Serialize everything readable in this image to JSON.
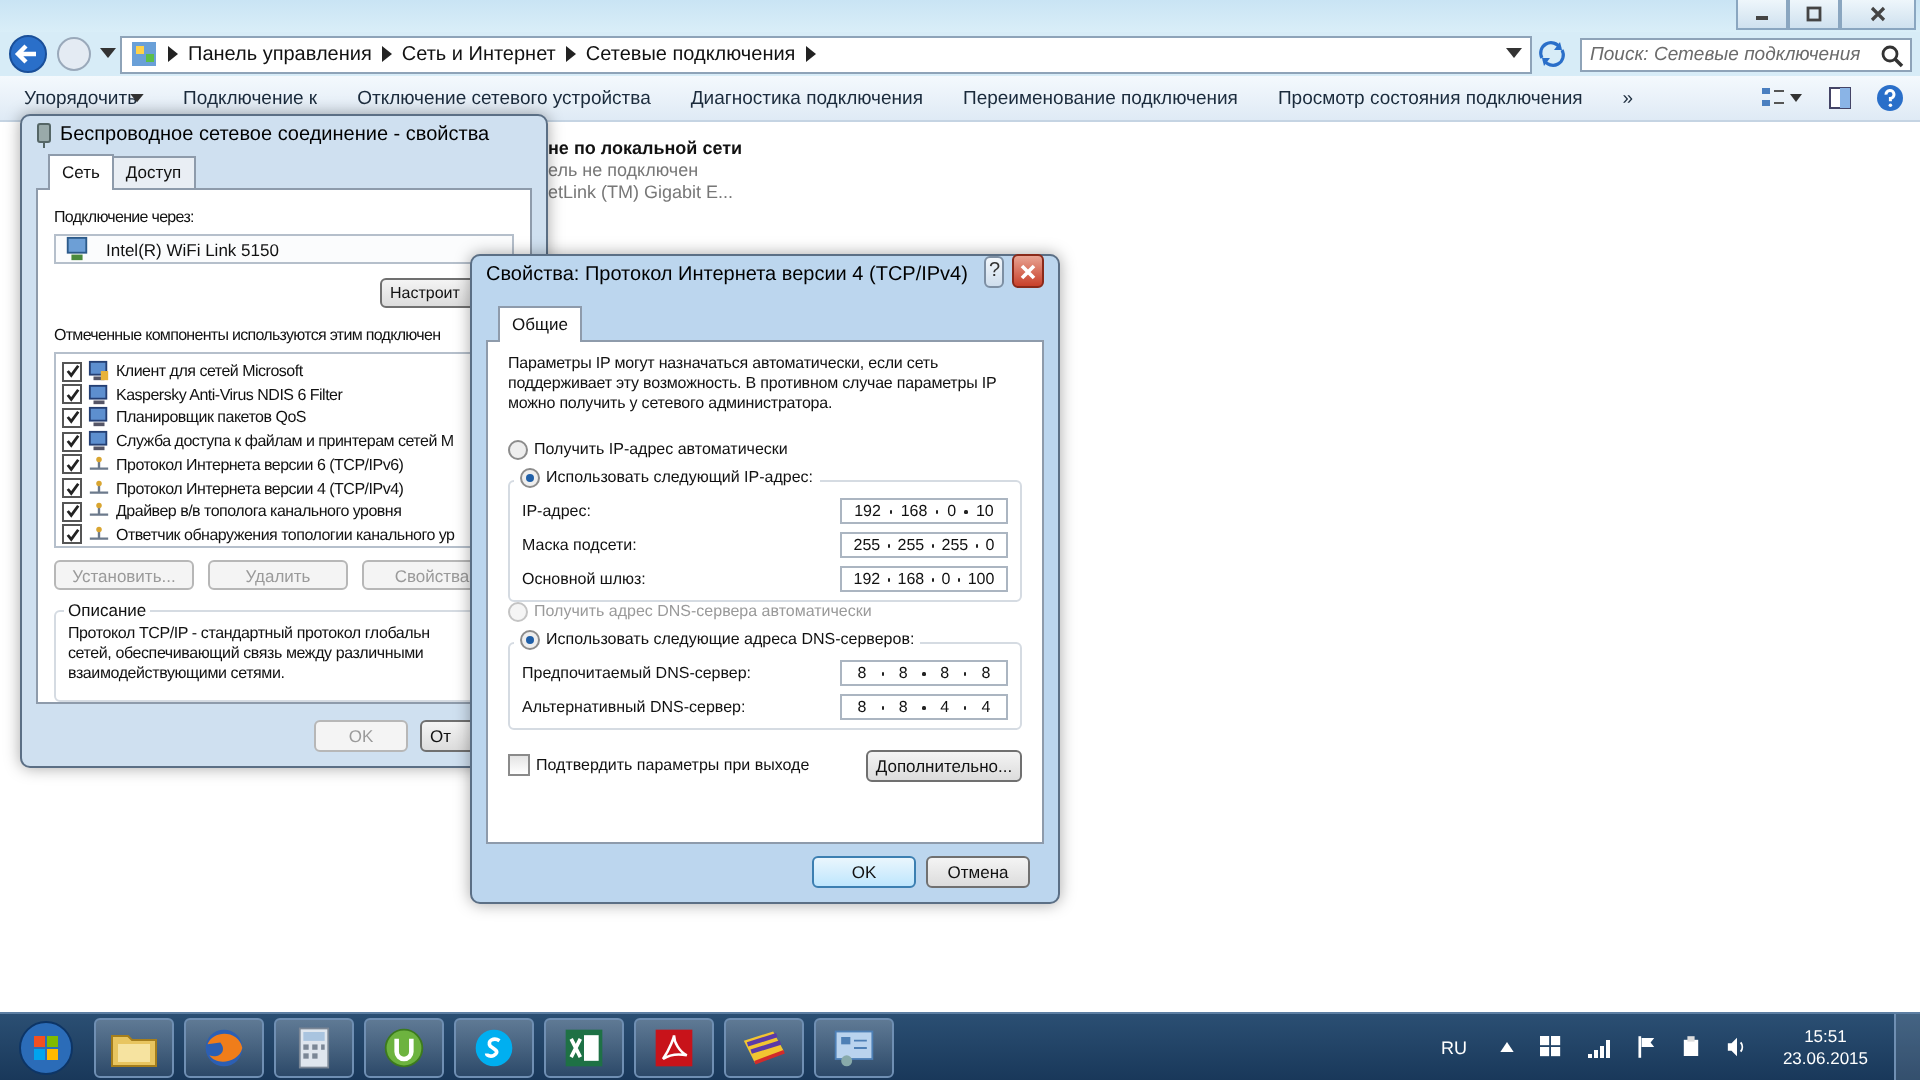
{
  "explorer": {
    "breadcrumb": [
      "Панель управления",
      "Сеть и Интернет",
      "Сетевые подключения"
    ],
    "search": {
      "placeholder": "Поиск: Сетевые подключения"
    },
    "toolbar": [
      {
        "label": "Упорядочить",
        "dropdown": true
      },
      {
        "label": "Подключение к",
        "dropdown": false
      },
      {
        "label": "Отключение сетевого устройства",
        "dropdown": false
      },
      {
        "label": "Диагностика подключения",
        "dropdown": false
      },
      {
        "label": "Переименование подключения",
        "dropdown": false
      },
      {
        "label": "Просмотр состояния подключения",
        "dropdown": false
      }
    ],
    "more": "»",
    "connection": {
      "name": "не по локальной сети",
      "status": "ель не подключен",
      "adapter": "etLink (TM) Gigabit E..."
    }
  },
  "properties_dialog": {
    "title": "Беспроводное сетевое соединение - свойства",
    "tabs": [
      {
        "label": "Сеть",
        "selected": true
      },
      {
        "label": "Доступ",
        "selected": false
      }
    ],
    "connect_via_label": "Подключение через:",
    "adapter": "Intel(R) WiFi Link 5150",
    "configure_button": "Настроит",
    "components_label": "Отмеченные компоненты используются этим подключен",
    "components": [
      {
        "name": "Клиент для сетей Microsoft",
        "checked": true,
        "kind": "client"
      },
      {
        "name": "Kaspersky Anti-Virus NDIS 6 Filter",
        "checked": true,
        "kind": "service"
      },
      {
        "name": "Планировщик пакетов QoS",
        "checked": true,
        "kind": "service"
      },
      {
        "name": "Служба доступа к файлам и принтерам сетей M",
        "checked": true,
        "kind": "service"
      },
      {
        "name": "Протокол Интернета версии 6 (TCP/IPv6)",
        "checked": true,
        "kind": "protocol"
      },
      {
        "name": "Протокол Интернета версии 4 (TCP/IPv4)",
        "checked": true,
        "kind": "protocol"
      },
      {
        "name": "Драйвер в/в тополога канального уровня",
        "checked": true,
        "kind": "protocol"
      },
      {
        "name": "Ответчик обнаружения топологии канального ур",
        "checked": true,
        "kind": "protocol"
      }
    ],
    "buttons": [
      {
        "label": "Установить...",
        "disabled": true
      },
      {
        "label": "Удалить",
        "disabled": true
      },
      {
        "label": "Свойства",
        "disabled": true
      }
    ],
    "description": {
      "title": "Описание",
      "lines": [
        "Протокол TCP/IP - стандартный протокол глобальн",
        "сетей, обеспечивающий связь между различными",
        "взаимодействующими сетями."
      ]
    },
    "footer_buttons": [
      {
        "label": "OK",
        "disabled": true
      },
      {
        "label": "От",
        "disabled": false
      }
    ]
  },
  "ipv4_dialog": {
    "title": "Свойства: Протокол Интернета версии 4 (TCP/IPv4)",
    "help": "?",
    "tabs": [
      {
        "label": "Общие",
        "selected": true
      }
    ],
    "intro": "Параметры IP могут назначаться автоматически, если сеть поддерживает эту возможность. В противном случае параметры IP можно получить у сетевого администратора.",
    "ip_mode": [
      {
        "label": "Получить IP-адрес автоматически",
        "selected": false,
        "disabled": false
      },
      {
        "label": "Использовать следующий IP-адрес:",
        "selected": true,
        "disabled": false
      }
    ],
    "ip_fields": [
      {
        "label": "IP-адрес:",
        "octets": [
          "192",
          "168",
          "0",
          "10"
        ]
      },
      {
        "label": "Маска подсети:",
        "octets": [
          "255",
          "255",
          "255",
          "0"
        ]
      },
      {
        "label": "Основной шлюз:",
        "octets": [
          "192",
          "168",
          "0",
          "100"
        ]
      }
    ],
    "dns_mode": [
      {
        "label": "Получить адрес DNS-сервера автоматически",
        "selected": false,
        "disabled": true
      },
      {
        "label": "Использовать следующие адреса DNS-серверов:",
        "selected": true,
        "disabled": false
      }
    ],
    "dns_fields": [
      {
        "label": "Предпочитаемый DNS-сервер:",
        "octets": [
          "8",
          "8",
          "8",
          "8"
        ]
      },
      {
        "label": "Альтернативный DNS-сервер:",
        "octets": [
          "8",
          "8",
          "4",
          "4"
        ]
      }
    ],
    "validate": {
      "label": "Подтвердить параметры при выходе",
      "checked": false
    },
    "advanced_button": "Дополнительно...",
    "ok_button": "OK",
    "cancel_button": "Отмена"
  },
  "taskbar": {
    "apps": [
      {
        "kind": "folder"
      },
      {
        "kind": "browser"
      },
      {
        "kind": "calculator"
      },
      {
        "kind": "torrent"
      },
      {
        "kind": "chat"
      },
      {
        "kind": "spreadsheet"
      },
      {
        "kind": "pdf"
      },
      {
        "kind": "archive"
      },
      {
        "kind": "control"
      }
    ],
    "language": "RU",
    "time": "15:51",
    "date": "23.06.2015"
  }
}
